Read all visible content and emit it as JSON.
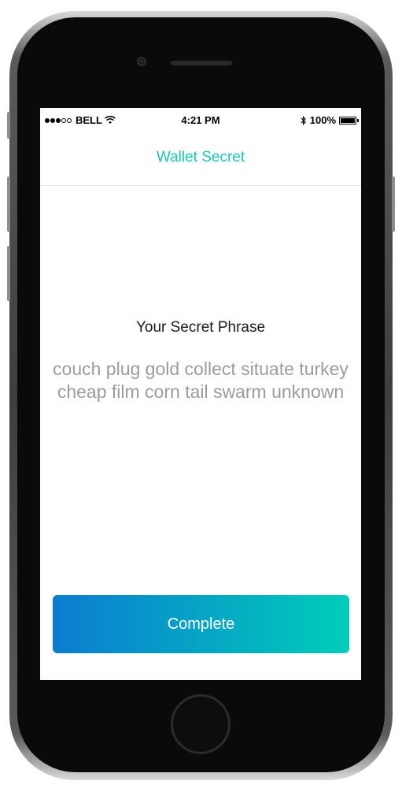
{
  "status_bar": {
    "carrier": "BELL",
    "time": "4:21 PM",
    "battery": "100%",
    "battery_level": 1.0
  },
  "nav": {
    "title": "Wallet Secret"
  },
  "content": {
    "heading": "Your Secret Phrase",
    "phrase": "couch plug gold collect situate turkey cheap film corn tail swarm unknown"
  },
  "actions": {
    "complete_label": "Complete"
  },
  "colors": {
    "accent": "#1cc7b3",
    "button_gradient_start": "#0b7cd0",
    "button_gradient_end": "#00cdb9",
    "phrase_text": "#9c9c9c"
  }
}
